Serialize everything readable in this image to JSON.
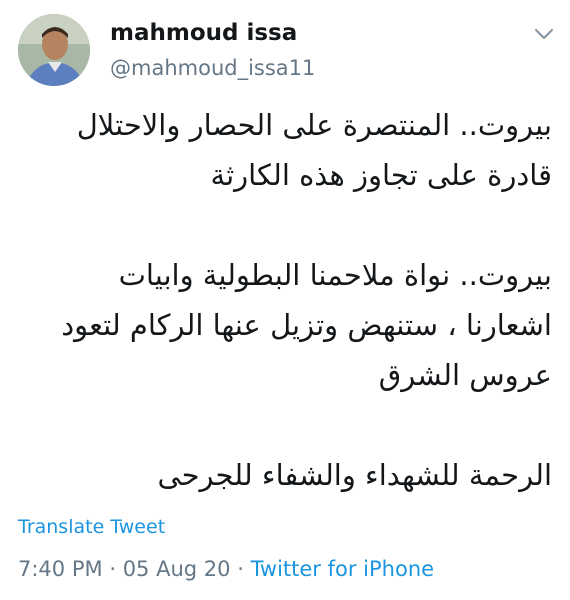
{
  "user": {
    "display_name": "mahmoud issa",
    "handle": "@mahmoud_issa11"
  },
  "tweet": {
    "lines": [
      "بيروت.. المنتصرة على الحصار والاحتلال",
      "قادرة على تجاوز هذه الكارثة",
      "بيروت.. نواة ملاحمنا البطولية وابيات",
      "اشعارنا ، ستنهض وتزيل عنها الركام لتعود",
      "عروس الشرق",
      "الرحمة للشهداء والشفاء للجرحى"
    ]
  },
  "footer": {
    "translate_label": "Translate Tweet",
    "time": "7:40 PM",
    "separator": "·",
    "date": "05 Aug 20",
    "source": "Twitter for iPhone"
  },
  "colors": {
    "link": "#1b95e0",
    "secondary_text": "#657786",
    "primary_text": "#14171a"
  },
  "icons": {
    "caret": "chevron-down-icon"
  }
}
